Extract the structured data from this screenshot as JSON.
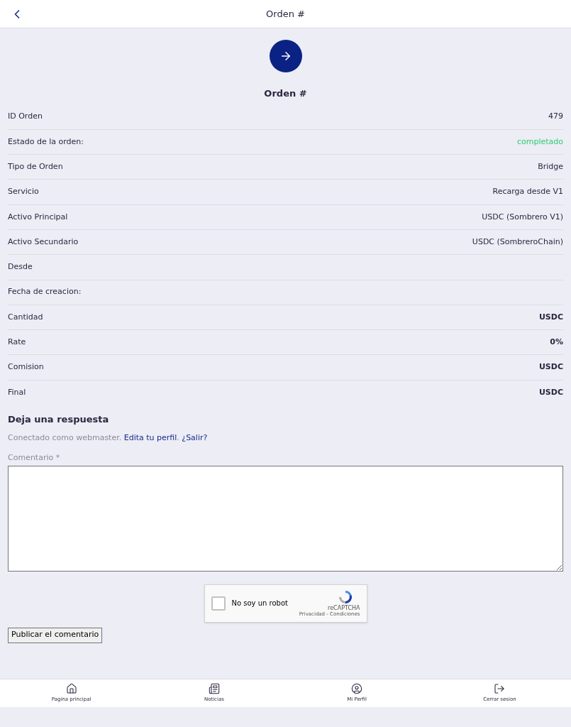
{
  "header": {
    "title": "Orden #"
  },
  "order": {
    "title": "Orden #",
    "rows": [
      {
        "label": "ID Orden",
        "value": "479",
        "kind": "plain"
      },
      {
        "label": "Estado de la orden:",
        "value": "completado",
        "kind": "status"
      },
      {
        "label": "Tipo de Orden",
        "value": "Bridge",
        "kind": "plain"
      },
      {
        "label": "Servicio",
        "value": "Recarga desde V1",
        "kind": "plain"
      },
      {
        "label": "Activo Principal",
        "value": "USDC (Sombrero V1)",
        "kind": "plain"
      },
      {
        "label": "Activo Secundario",
        "value": "USDC (SombreroChain)",
        "kind": "plain"
      },
      {
        "label": "Desde"
      },
      {
        "label": "Fecha de creacion:"
      },
      {
        "label": "Cantidad",
        "value": "USDC",
        "kind": "bold"
      },
      {
        "label": "Rate",
        "value": "0%",
        "kind": "bold"
      },
      {
        "label": "Comision",
        "value": "USDC",
        "kind": "bold"
      },
      {
        "label": "Final",
        "value": "USDC",
        "kind": "bold"
      }
    ]
  },
  "reply": {
    "title": "Deja una respuesta",
    "logged_in": "Conectado como webmaster.",
    "edit_link": "Edita tu perfil",
    "separator": ".",
    "logout_link": "¿Salir?",
    "comment_label": "Comentario *",
    "captcha": {
      "label": "No soy un robot",
      "checked": false,
      "brand": "reCAPTCHA",
      "terms": "Privacidad - Condiciones"
    },
    "submit": "Publicar el comentario"
  },
  "nav": [
    {
      "label": "Pagina principal",
      "kind": "home"
    },
    {
      "label": "Noticias",
      "kind": "news"
    },
    {
      "label": "Mi Perfil",
      "kind": "profile"
    },
    {
      "label": "Cerrar sesion",
      "kind": "logout"
    }
  ]
}
